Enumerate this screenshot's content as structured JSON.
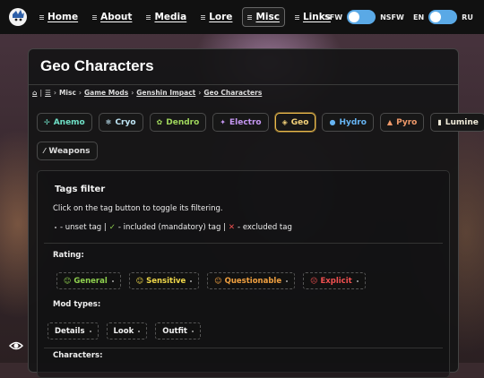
{
  "nav": {
    "items": [
      {
        "label": "Home",
        "active": false
      },
      {
        "label": "About",
        "active": false
      },
      {
        "label": "Media",
        "active": false
      },
      {
        "label": "Lore",
        "active": false
      },
      {
        "label": "Misc",
        "active": true
      },
      {
        "label": "Links",
        "active": false
      }
    ],
    "content_toggle": {
      "left": "SFW",
      "right": "NSFW"
    },
    "lang_toggle": {
      "left": "EN",
      "right": "RU"
    }
  },
  "page": {
    "title": "Geo Characters",
    "breadcrumb": [
      {
        "label": "⌂",
        "link": true
      },
      {
        "label": "☰",
        "link": true
      },
      {
        "label": "Misc",
        "link": false
      },
      {
        "label": "Game Mods",
        "link": true
      },
      {
        "label": "Genshin Impact",
        "link": true
      },
      {
        "label": "Geo Characters",
        "link": true
      }
    ],
    "breadcrumb_sep_home": "|",
    "breadcrumb_sep": "›"
  },
  "elements": [
    {
      "label": "Anemo",
      "icon": "✢",
      "color": "#6fe0c6",
      "active": false
    },
    {
      "label": "Cryo",
      "icon": "❄",
      "color": "#bfe6f5",
      "active": false
    },
    {
      "label": "Dendro",
      "icon": "✿",
      "color": "#9fd65c",
      "active": false
    },
    {
      "label": "Electro",
      "icon": "✦",
      "color": "#c597f2",
      "active": false
    },
    {
      "label": "Geo",
      "icon": "◈",
      "color": "#f3d27a",
      "active": true
    },
    {
      "label": "Hydro",
      "icon": "●",
      "color": "#66b4f2",
      "active": false
    },
    {
      "label": "Pyro",
      "icon": "▲",
      "color": "#f09a6a",
      "active": false
    },
    {
      "label": "Lumine",
      "icon": "▮",
      "color": "#f1ecda",
      "active": false
    },
    {
      "label": "Weapons",
      "icon": "⁄",
      "color": "#dddddd",
      "active": false
    }
  ],
  "tags_filter": {
    "title": "Tags filter",
    "description": "Click on the tag button to toggle its filtering.",
    "legend": {
      "unset": "- unset tag |",
      "included_mark": "✓",
      "included": "- included (mandatory) tag |",
      "excluded_mark": "✕",
      "excluded": "- excluded tag"
    },
    "rating": {
      "title": "Rating:",
      "tags": [
        {
          "label": "General",
          "emoji": "☺",
          "color": "#8fd14f"
        },
        {
          "label": "Sensitive",
          "emoji": "☺",
          "color": "#f0d84a"
        },
        {
          "label": "Questionable",
          "emoji": "☺",
          "color": "#f0a040"
        },
        {
          "label": "Explicit",
          "emoji": "☹",
          "color": "#f05050"
        }
      ]
    },
    "mod_types": {
      "title": "Mod types:",
      "tags": [
        {
          "label": "Details"
        },
        {
          "label": "Look"
        },
        {
          "label": "Outfit"
        }
      ]
    },
    "characters": {
      "title": "Characters:"
    }
  },
  "colors": {
    "accent": "#5aa9e6",
    "geo_gold": "#e8b84a"
  }
}
